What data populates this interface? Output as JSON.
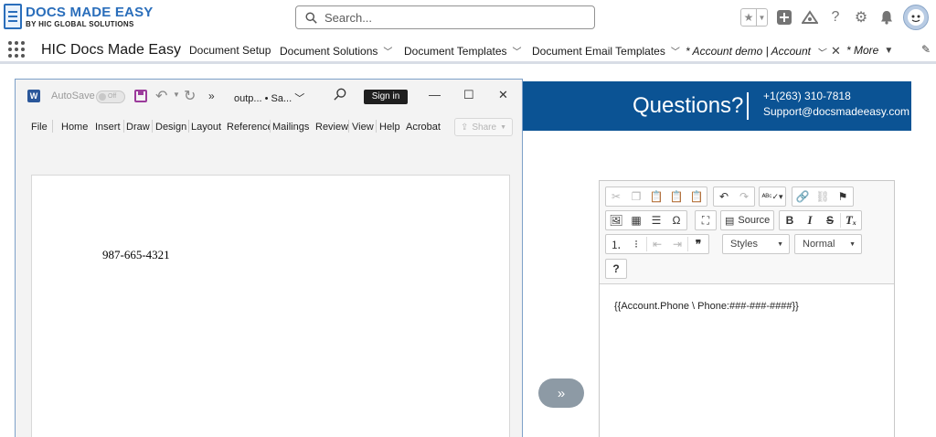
{
  "header": {
    "logo_main": "DOCS MADE EASY",
    "logo_sub": "BY HIC GLOBAL SOLUTIONS",
    "search_placeholder": "Search...",
    "icons": [
      "star-icon",
      "chevron-down-icon",
      "add-icon",
      "trailhead-icon",
      "help-icon",
      "settings-icon",
      "bell-icon",
      "avatar"
    ]
  },
  "nav": {
    "app_name": "HIC Docs Made Easy",
    "items": [
      {
        "label": "Document Setup"
      },
      {
        "label": "Document Solutions"
      },
      {
        "label": "Document Templates"
      },
      {
        "label": "Document Email Templates"
      },
      {
        "label": "* Account demo | Account"
      },
      {
        "label": "* More"
      }
    ]
  },
  "banner": {
    "question": "Questions?",
    "phone": "+1(263) 310-7818",
    "email": "Support@docsmadeeasy.com",
    "color": "#0b5394"
  },
  "word": {
    "logo_letter": "W",
    "autosave_label": "AutoSave",
    "toggle_label": "Off",
    "more_label": "»",
    "file_name": "outp... • Sa...",
    "signin_label": "Sign in",
    "ribbon_tabs": [
      "File",
      "Home",
      "Insert",
      "Draw",
      "Design",
      "Layout",
      "Reference",
      "Mailings",
      "Review",
      "View",
      "Help",
      "Acrobat"
    ],
    "share_label": "Share",
    "document_text": "987-665-4321"
  },
  "convert_label": "»",
  "editor": {
    "source_label": "Source",
    "styles_label": "Styles",
    "format_label": "Normal",
    "help_label": "?",
    "content": "{{Account.Phone \\ Phone:###-###-####}}"
  }
}
